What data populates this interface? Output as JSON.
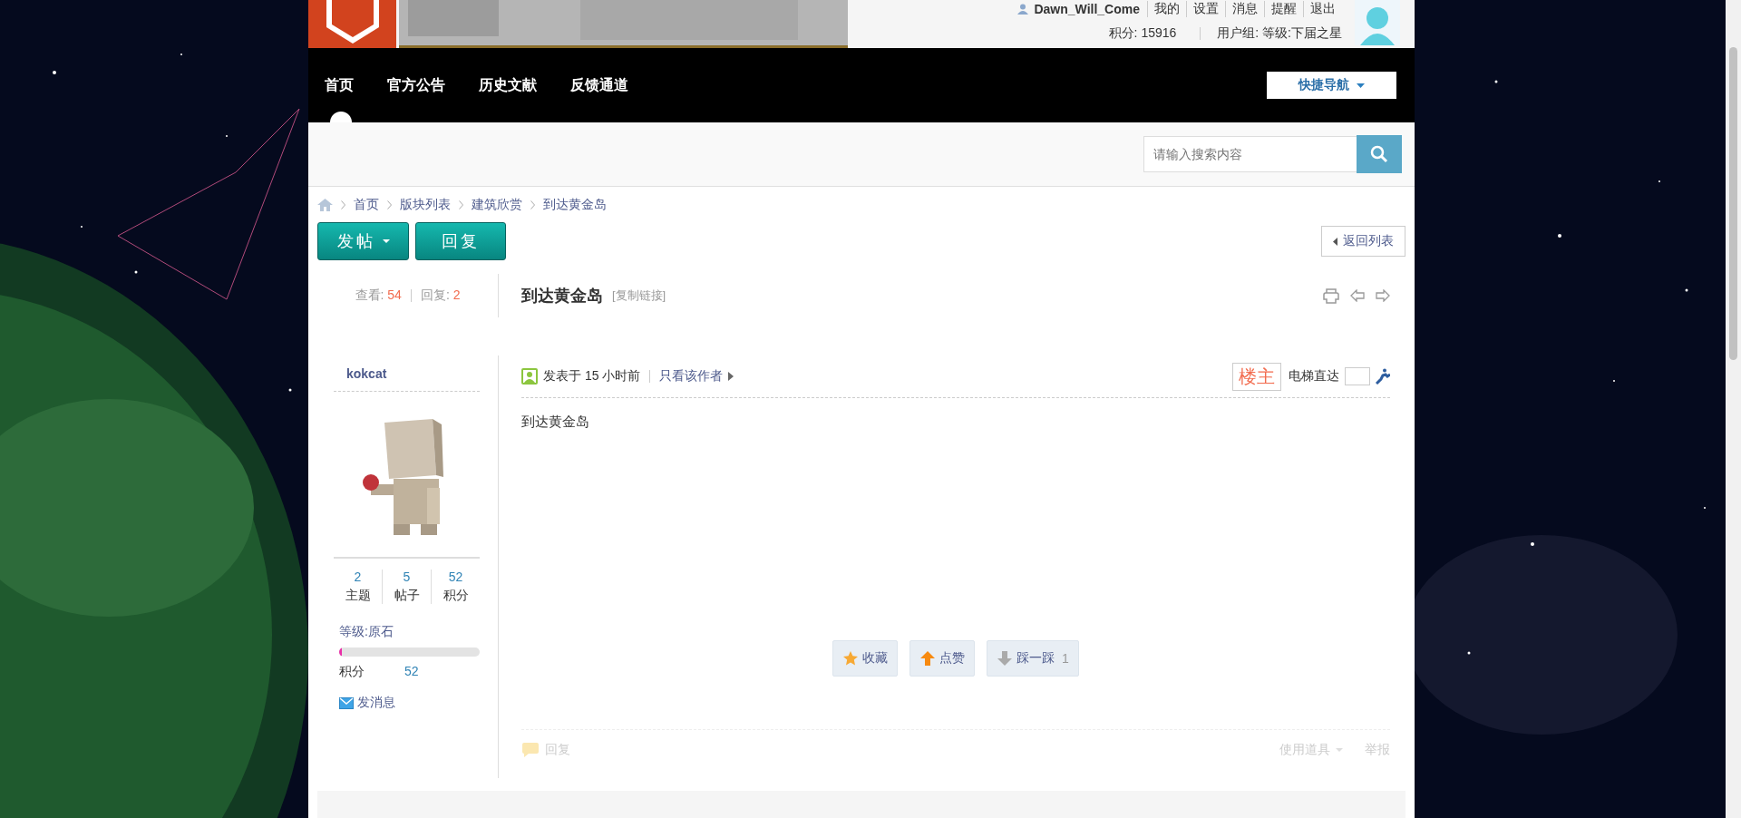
{
  "user_bar": {
    "username": "Dawn_Will_Come",
    "links": [
      "我的",
      "设置",
      "消息",
      "提醒",
      "退出"
    ],
    "points": "积分: 15916",
    "user_group": "用户组: 等级:下届之星"
  },
  "nav": {
    "items": [
      {
        "label": "首页",
        "selected": true
      },
      {
        "label": "官方公告",
        "selected": false
      },
      {
        "label": "历史文献",
        "selected": false
      },
      {
        "label": "反馈通道",
        "selected": false
      }
    ],
    "quick_nav": "快捷导航"
  },
  "search": {
    "placeholder": "请输入搜索内容"
  },
  "breadcrumb": [
    "首页",
    "版块列表",
    "建筑欣赏",
    "到达黄金岛"
  ],
  "actions": {
    "new_post": "发帖",
    "reply": "回复",
    "back": "返回列表"
  },
  "thread": {
    "views_label": "查看:",
    "views": "54",
    "replies_label": "回复:",
    "replies": "2",
    "title": "到达黄金岛",
    "copy_link": "[复制链接]"
  },
  "post": {
    "author": "kokcat",
    "stats": [
      {
        "value": "2",
        "label": "主题"
      },
      {
        "value": "5",
        "label": "帖子"
      },
      {
        "value": "52",
        "label": "积分"
      }
    ],
    "level_label": "等级:原石",
    "level": 0.02,
    "points_label": "积分",
    "points": "52",
    "message": "发消息",
    "posted": "发表于 15 小时前",
    "only_author": "只看该作者",
    "floor": "楼主",
    "jump_label": "电梯直达",
    "content": "到达黄金岛",
    "reactions": [
      {
        "kind": "favorite",
        "label": "收藏"
      },
      {
        "kind": "like",
        "label": "点赞"
      },
      {
        "kind": "dislike",
        "label": "踩一踩",
        "count": "1"
      }
    ],
    "reply": "回复",
    "tools": "使用道具",
    "report": "举报"
  }
}
